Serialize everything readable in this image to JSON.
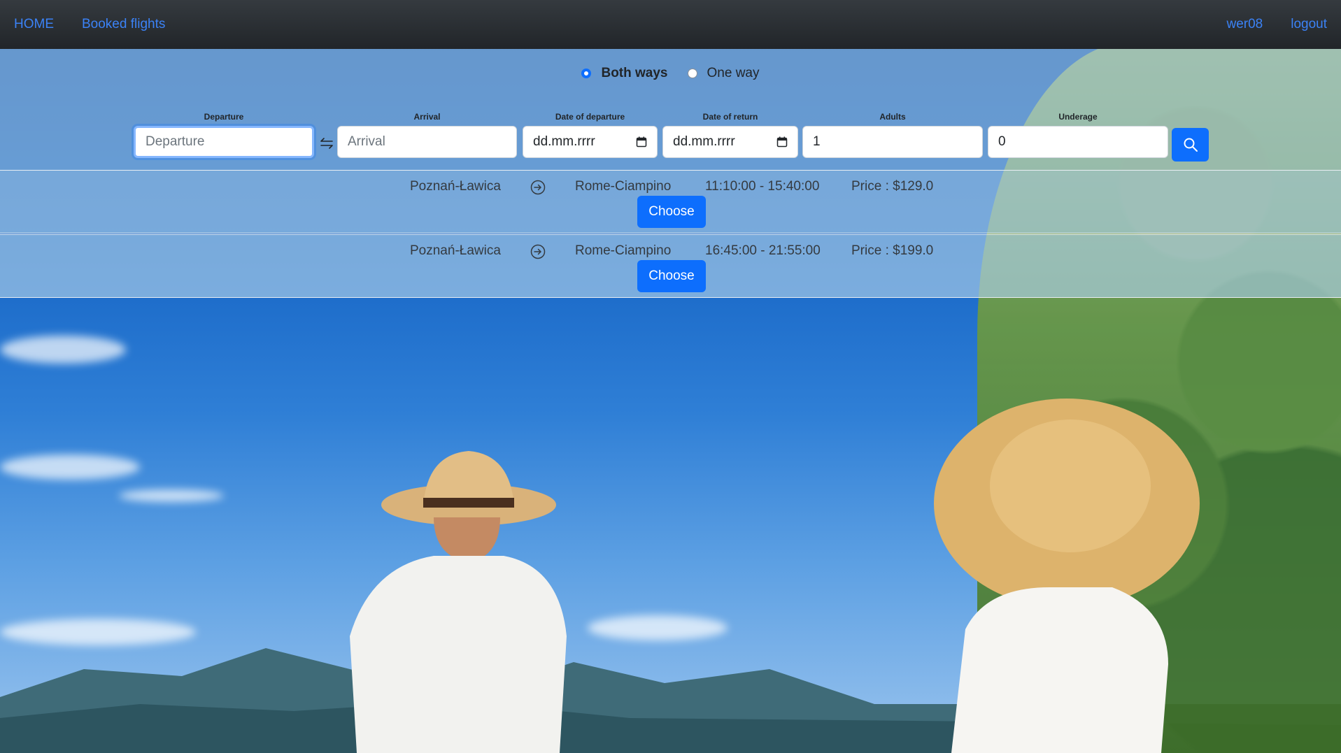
{
  "navbar": {
    "home": "HOME",
    "booked_flights": "Booked flights",
    "username": "wer08",
    "logout": "logout"
  },
  "search": {
    "trip_types": {
      "both_ways": "Both ways",
      "one_way": "One way",
      "selected": "both_ways"
    },
    "departure": {
      "label": "Departure",
      "placeholder": "Departure"
    },
    "arrival": {
      "label": "Arrival",
      "placeholder": "Arrival"
    },
    "date_departure": {
      "label": "Date of departure",
      "value": "dd.mm.rrrr"
    },
    "date_return": {
      "label": "Date of return",
      "value": "dd.mm.rrrr"
    },
    "adults": {
      "label": "Adults",
      "value": "1"
    },
    "underage": {
      "label": "Underage",
      "value": "0"
    }
  },
  "flights": [
    {
      "from": "Poznań-Ławica",
      "to": "Rome-Ciampino",
      "time": "11:10:00 - 15:40:00",
      "price": "Price : $129.0",
      "action": "Choose"
    },
    {
      "from": "Poznań-Ławica",
      "to": "Rome-Ciampino",
      "time": "16:45:00 - 21:55:00",
      "price": "Price : $199.0",
      "action": "Choose"
    }
  ],
  "colors": {
    "accent": "#0d6efd",
    "navbar": "#212529",
    "link": "#3b82f6"
  }
}
